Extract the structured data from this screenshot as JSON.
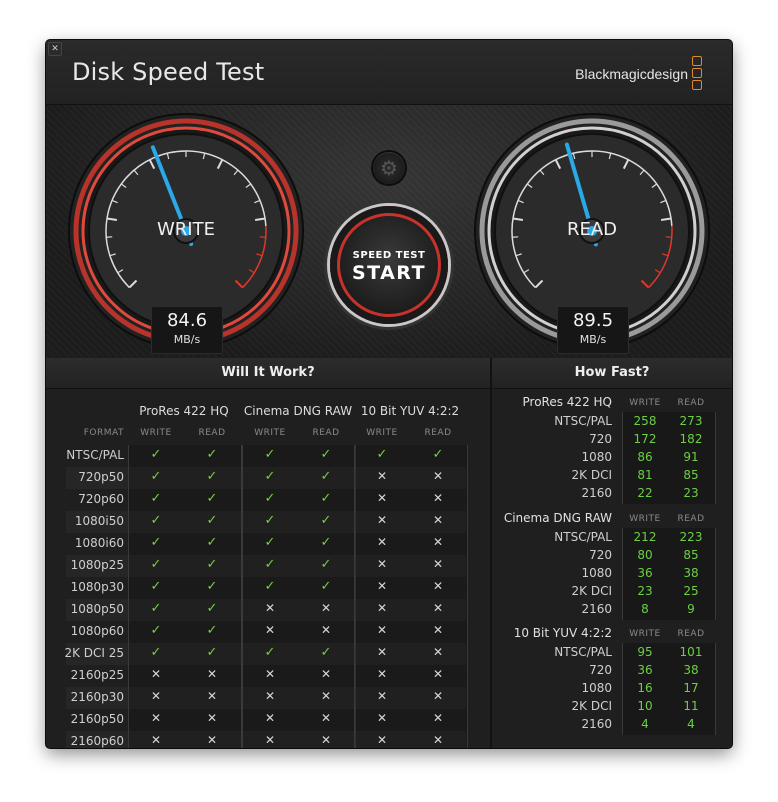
{
  "window": {
    "close_glyph": "✕",
    "title": "Disk Speed Test",
    "brand": "Blackmagicdesign"
  },
  "gauges": {
    "write": {
      "label": "WRITE",
      "value": "84.6",
      "unit": "MB/s",
      "fraction": 0.42
    },
    "read": {
      "label": "READ",
      "value": "89.5",
      "unit": "MB/s",
      "fraction": 0.44
    }
  },
  "controls": {
    "settings_icon": "gear-icon",
    "start_top": "SPEED TEST",
    "start_main": "START"
  },
  "colors": {
    "accent_red": "#c6332b",
    "needle_blue": "#2aa8e8",
    "check_green": "#76d04a",
    "brand_orange": "#e0882c"
  },
  "will_it_work": {
    "title": "Will It Work?",
    "format_header": "FORMAT",
    "groups": [
      {
        "name": "ProRes 422 HQ",
        "write": "WRITE",
        "read": "READ"
      },
      {
        "name": "Cinema DNG RAW",
        "write": "WRITE",
        "read": "READ"
      },
      {
        "name": "10 Bit YUV 4:2:2",
        "write": "WRITE",
        "read": "READ"
      }
    ],
    "rows": [
      {
        "format": "NTSC/PAL",
        "marks": [
          1,
          1,
          1,
          1,
          1,
          1
        ]
      },
      {
        "format": "720p50",
        "marks": [
          1,
          1,
          1,
          1,
          0,
          0
        ]
      },
      {
        "format": "720p60",
        "marks": [
          1,
          1,
          1,
          1,
          0,
          0
        ]
      },
      {
        "format": "1080i50",
        "marks": [
          1,
          1,
          1,
          1,
          0,
          0
        ]
      },
      {
        "format": "1080i60",
        "marks": [
          1,
          1,
          1,
          1,
          0,
          0
        ]
      },
      {
        "format": "1080p25",
        "marks": [
          1,
          1,
          1,
          1,
          0,
          0
        ]
      },
      {
        "format": "1080p30",
        "marks": [
          1,
          1,
          1,
          1,
          0,
          0
        ]
      },
      {
        "format": "1080p50",
        "marks": [
          1,
          1,
          0,
          0,
          0,
          0
        ]
      },
      {
        "format": "1080p60",
        "marks": [
          1,
          1,
          0,
          0,
          0,
          0
        ]
      },
      {
        "format": "2K DCI 25",
        "marks": [
          1,
          1,
          1,
          1,
          0,
          0
        ]
      },
      {
        "format": "2160p25",
        "marks": [
          0,
          0,
          0,
          0,
          0,
          0
        ]
      },
      {
        "format": "2160p30",
        "marks": [
          0,
          0,
          0,
          0,
          0,
          0
        ]
      },
      {
        "format": "2160p50",
        "marks": [
          0,
          0,
          0,
          0,
          0,
          0
        ]
      },
      {
        "format": "2160p60",
        "marks": [
          0,
          0,
          0,
          0,
          0,
          0
        ]
      }
    ],
    "yes_glyph": "✓",
    "no_glyph": "✕"
  },
  "how_fast": {
    "title": "How Fast?",
    "groups": [
      {
        "name": "ProRes 422 HQ",
        "write": "WRITE",
        "read": "READ",
        "rows": [
          [
            "NTSC/PAL",
            "258",
            "273"
          ],
          [
            "720",
            "172",
            "182"
          ],
          [
            "1080",
            "86",
            "91"
          ],
          [
            "2K DCI",
            "81",
            "85"
          ],
          [
            "2160",
            "22",
            "23"
          ]
        ]
      },
      {
        "name": "Cinema DNG RAW",
        "write": "WRITE",
        "read": "READ",
        "rows": [
          [
            "NTSC/PAL",
            "212",
            "223"
          ],
          [
            "720",
            "80",
            "85"
          ],
          [
            "1080",
            "36",
            "38"
          ],
          [
            "2K DCI",
            "23",
            "25"
          ],
          [
            "2160",
            "8",
            "9"
          ]
        ]
      },
      {
        "name": "10 Bit YUV 4:2:2",
        "write": "WRITE",
        "read": "READ",
        "rows": [
          [
            "NTSC/PAL",
            "95",
            "101"
          ],
          [
            "720",
            "36",
            "38"
          ],
          [
            "1080",
            "16",
            "17"
          ],
          [
            "2K DCI",
            "10",
            "11"
          ],
          [
            "2160",
            "4",
            "4"
          ]
        ]
      }
    ]
  }
}
